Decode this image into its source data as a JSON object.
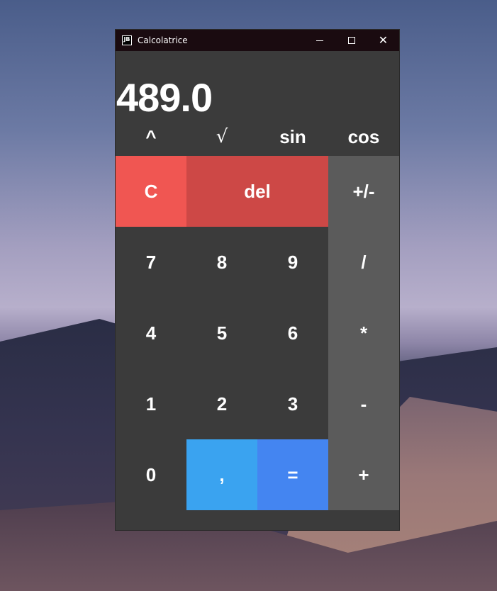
{
  "window": {
    "title": "Calcolatrice",
    "icon_text": "JB"
  },
  "display": {
    "value": "489.0"
  },
  "scientific": {
    "pow": "^",
    "sqrt": "√",
    "sin": "sin",
    "cos": "cos"
  },
  "keys": {
    "clear": "C",
    "del": "del",
    "sign": "+/-",
    "seven": "7",
    "eight": "8",
    "nine": "9",
    "divide": "/",
    "four": "4",
    "five": "5",
    "six": "6",
    "multiply": "*",
    "one": "1",
    "two": "2",
    "three": "3",
    "minus": "-",
    "zero": "0",
    "comma": ",",
    "equals": "=",
    "plus": "+"
  },
  "colors": {
    "clear": "#f05652",
    "del": "#cd4846",
    "comma": "#3aa3f0",
    "equals": "#4485f1",
    "operator": "#5b5b5b",
    "background": "#3b3b3b"
  }
}
